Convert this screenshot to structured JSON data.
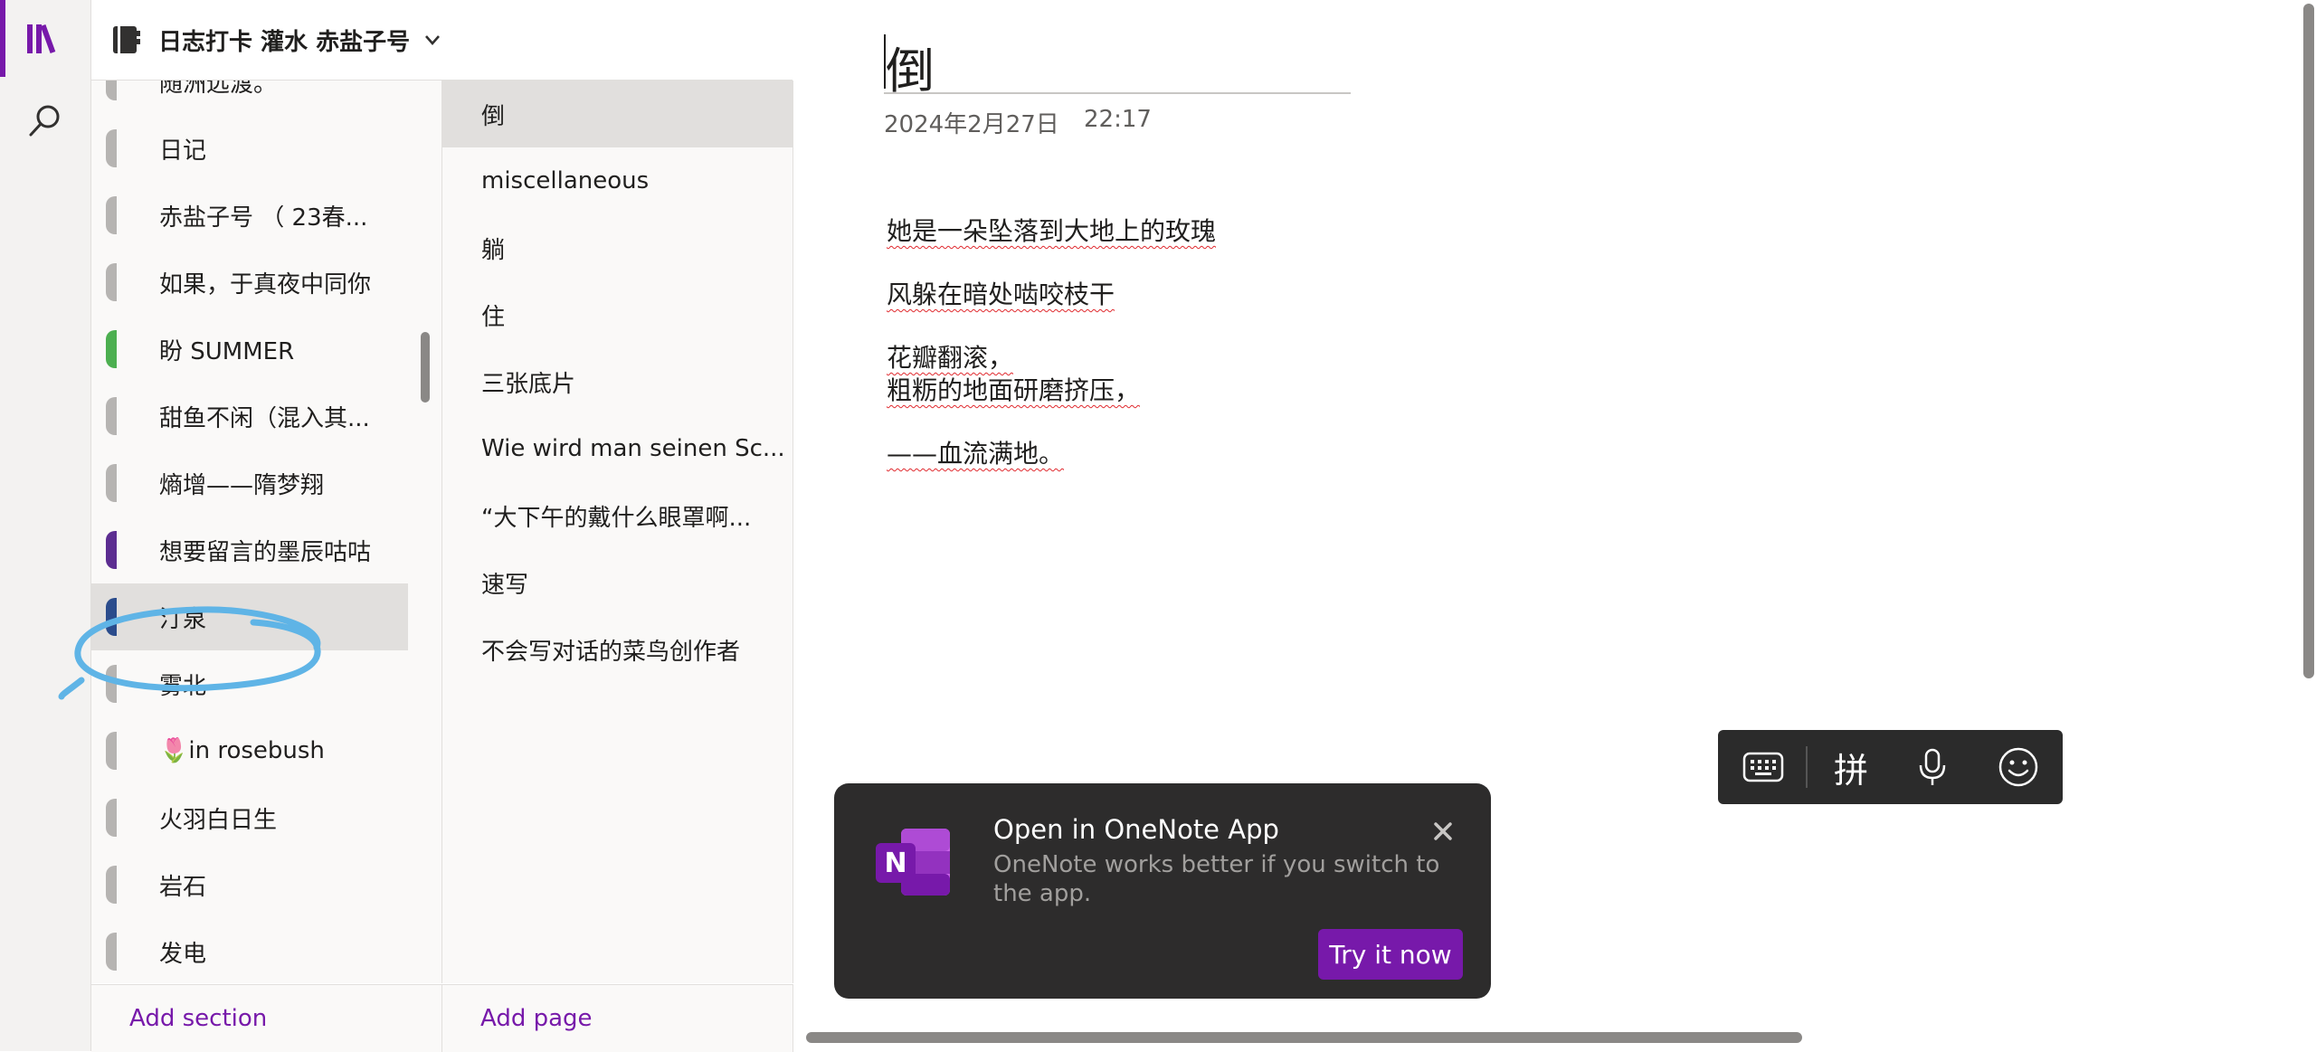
{
  "colors": {
    "accent": "#7719aa",
    "annotation": "#5fb4e6"
  },
  "rail": {
    "items": [
      {
        "icon": "notebooks-icon",
        "active": true
      },
      {
        "icon": "search-icon",
        "active": false
      }
    ]
  },
  "header": {
    "notebook_title": "日志打卡 灌水 赤盐子号",
    "icon": "notebook-icon",
    "chevron": "chevron-down-icon"
  },
  "sections": {
    "items": [
      {
        "label": "随洲远渡。",
        "color": "#b6b4b2"
      },
      {
        "label": "日记",
        "color": "#b6b4b2"
      },
      {
        "label": "赤盐子号 （ 23春...",
        "color": "#b6b4b2"
      },
      {
        "label": "如果，于真夜中同你",
        "color": "#b6b4b2"
      },
      {
        "label": "盼 SUMMER",
        "color": "#4caf50"
      },
      {
        "label": "甜鱼不闲（混入其...",
        "color": "#b6b4b2"
      },
      {
        "label": "熵增——隋梦翔",
        "color": "#b6b4b2"
      },
      {
        "label": "想要留言的墨辰咕咕",
        "color": "#5c2d91"
      },
      {
        "label": "汀泉",
        "color": "#2b4c8c",
        "selected": true
      },
      {
        "label": "雾北",
        "color": "#b6b4b2"
      },
      {
        "label": "🌷in rosebush",
        "color": "#b6b4b2"
      },
      {
        "label": "火羽白日生",
        "color": "#b6b4b2"
      },
      {
        "label": "岩石",
        "color": "#b6b4b2"
      },
      {
        "label": "发电",
        "color": "#b6b4b2"
      }
    ],
    "add_label": "Add section"
  },
  "pages": {
    "items": [
      {
        "label": "倒",
        "selected": true
      },
      {
        "label": "miscellaneous"
      },
      {
        "label": "躺"
      },
      {
        "label": "住"
      },
      {
        "label": "三张底片"
      },
      {
        "label": "Wie wird man seinen Sc..."
      },
      {
        "label": "“大下午的戴什么眼罩啊..."
      },
      {
        "label": "速写"
      },
      {
        "label": "不会写对话的菜鸟创作者"
      }
    ],
    "add_label": "Add page"
  },
  "note": {
    "title": "倒",
    "date": "2024年2月27日",
    "time": "22:17",
    "lines": [
      "她是一朵坠落到大地上的玫瑰",
      "风躲在暗处啮咬枝干",
      "花瓣翻滚，",
      "粗粝的地面研磨挤压，",
      "——血流满地。"
    ]
  },
  "ime": {
    "keyboard_icon": "keyboard-icon",
    "pinyin_label": "拼",
    "mic_icon": "microphone-icon",
    "emoji_icon": "emoji-icon"
  },
  "toast": {
    "title": "Open in OneNote App",
    "description": "OneNote works better if you switch to the app.",
    "button_label": "Try it now",
    "logo": "onenote-logo-icon",
    "close_icon": "close-icon"
  }
}
